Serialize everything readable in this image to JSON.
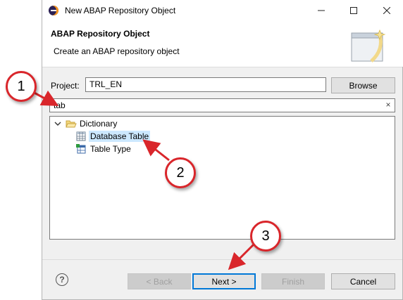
{
  "window": {
    "title": "New ABAP Repository Object",
    "minimize_label": "—",
    "maximize_label": "☐",
    "close_label": "✕"
  },
  "header": {
    "title": "ABAP Repository Object",
    "subtitle": "Create an ABAP repository object"
  },
  "form": {
    "project_label": "Project:",
    "project_value": "TRL_EN",
    "browse_label": "Browse",
    "search_value": "tab",
    "search_clear_label": "×"
  },
  "tree": {
    "root": {
      "label": "Dictionary",
      "expanded": true
    },
    "children": [
      {
        "label": "Database Table",
        "selected": true
      },
      {
        "label": "Table Type",
        "selected": false
      }
    ]
  },
  "footer": {
    "help_label": "?",
    "back_label": "< Back",
    "next_label": "Next >",
    "finish_label": "Finish",
    "cancel_label": "Cancel"
  },
  "callouts": [
    "1",
    "2",
    "3"
  ],
  "colors": {
    "callout_border": "#d9262b",
    "focus_blue": "#0078d7",
    "selection": "#cce8ff"
  }
}
